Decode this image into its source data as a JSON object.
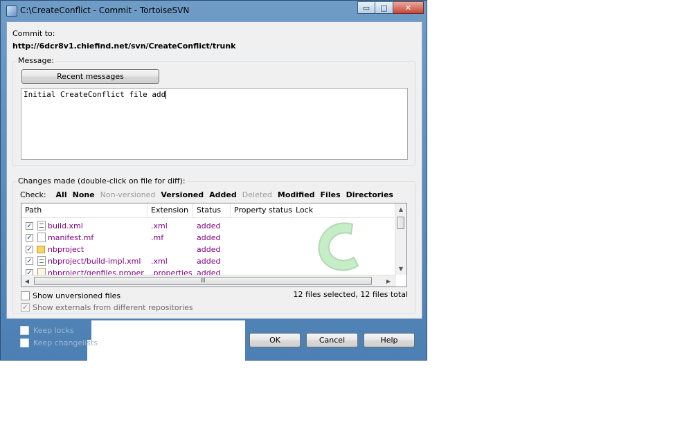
{
  "window": {
    "title": "C:\\CreateConflict - Commit - TortoiseSVN",
    "controls": {
      "minimize": "▭",
      "maximize": "□",
      "close": "✕"
    }
  },
  "commit": {
    "label": "Commit to:",
    "url": "http://6dcr8v1.chiefind.net/svn/CreateConflict/trunk"
  },
  "message": {
    "caption": "Message:",
    "recent_button": "Recent messages",
    "text": "Initial CreateConflict file add"
  },
  "changes": {
    "caption": "Changes made (double-click on file for diff):",
    "check_label": "Check:",
    "filters": [
      {
        "label": "All",
        "enabled": true
      },
      {
        "label": "None",
        "enabled": true
      },
      {
        "label": "Non-versioned",
        "enabled": false
      },
      {
        "label": "Versioned",
        "enabled": true
      },
      {
        "label": "Added",
        "enabled": true
      },
      {
        "label": "Deleted",
        "enabled": false
      },
      {
        "label": "Modified",
        "enabled": true
      },
      {
        "label": "Files",
        "enabled": true
      },
      {
        "label": "Directories",
        "enabled": true
      }
    ],
    "columns": [
      "Path",
      "Extension",
      "Status",
      "Property status",
      "Lock"
    ],
    "rows": [
      {
        "path": "build.xml",
        "extension": ".xml",
        "status": "added",
        "icon": "xml-file-icon"
      },
      {
        "path": "manifest.mf",
        "extension": ".mf",
        "status": "added",
        "icon": "file-icon"
      },
      {
        "path": "nbproject",
        "extension": "",
        "status": "added",
        "icon": "folder-icon"
      },
      {
        "path": "nbproject/build-impl.xml",
        "extension": ".xml",
        "status": "added",
        "icon": "xml-file-icon"
      },
      {
        "path": "nbproject/genfiles.proper",
        "extension": ".properties",
        "status": "added",
        "icon": "properties-file-icon"
      }
    ],
    "scroll_glyphs": {
      "up": "▲",
      "down": "▼",
      "left": "◀",
      "right": "▶",
      "grip": "III"
    },
    "summary": "12 files selected, 12 files total"
  },
  "options": {
    "show_unversioned": "Show unversioned files",
    "show_externals": "Show externals from different repositories",
    "keep_locks": "Keep locks",
    "keep_changelists": "Keep changelists"
  },
  "buttons": {
    "ok": "OK",
    "cancel": "Cancel",
    "help": "Help"
  },
  "check_glyph": "✓"
}
